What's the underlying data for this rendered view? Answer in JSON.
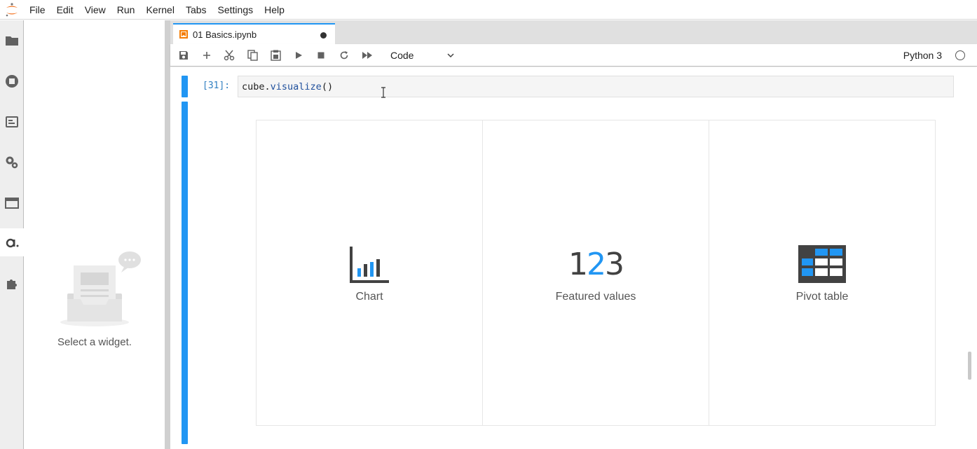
{
  "menubar": {
    "items": [
      "File",
      "Edit",
      "View",
      "Run",
      "Kernel",
      "Tabs",
      "Settings",
      "Help"
    ]
  },
  "activitybar": {
    "icons": [
      "folder-icon",
      "running-icon",
      "commands-icon",
      "property-inspector-icon",
      "tabs-icon",
      "atoti-icon",
      "extensions-icon"
    ]
  },
  "sidepanel": {
    "empty_text": "Select a widget."
  },
  "tab": {
    "title": "01 Basics.ipynb"
  },
  "toolbar": {
    "cell_type": "Code",
    "kernel": "Python 3"
  },
  "cell": {
    "prompt": "[31]:",
    "code_object": "cube",
    "code_dot": ".",
    "code_function": "visualize",
    "code_parens": "()"
  },
  "widget": {
    "options": [
      {
        "label": "Chart",
        "icon": "bar-chart-icon"
      },
      {
        "label": "Featured values",
        "icon": "featured-values-icon",
        "digits": [
          "1",
          "2",
          "3"
        ]
      },
      {
        "label": "Pivot table",
        "icon": "pivot-table-icon"
      }
    ]
  },
  "colors": {
    "accent": "#2196f3",
    "prompt": "#307fc1",
    "icon_dark": "#424242"
  }
}
